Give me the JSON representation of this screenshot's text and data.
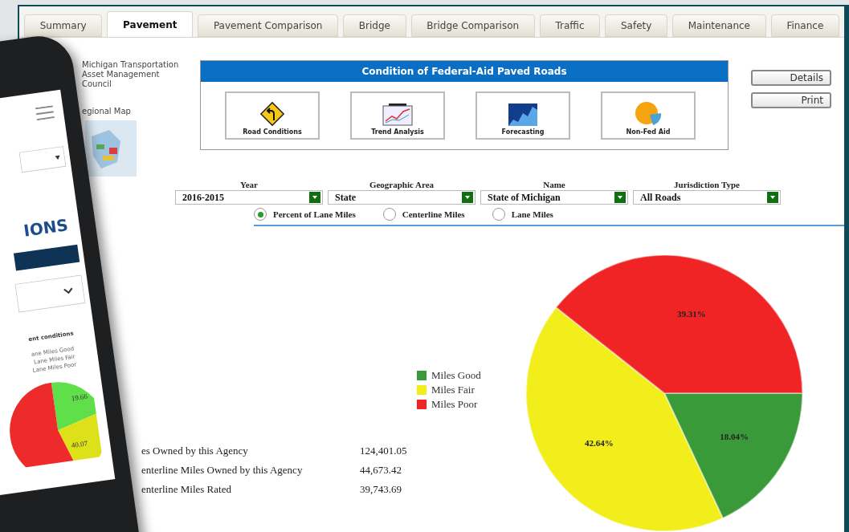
{
  "tabs": [
    {
      "label": "Summary",
      "selected": false
    },
    {
      "label": "Pavement",
      "selected": true
    },
    {
      "label": "Pavement Comparison",
      "selected": false
    },
    {
      "label": "Bridge",
      "selected": false
    },
    {
      "label": "Bridge Comparison",
      "selected": false
    },
    {
      "label": "Traffic",
      "selected": false
    },
    {
      "label": "Safety",
      "selected": false
    },
    {
      "label": "Maintenance",
      "selected": false
    },
    {
      "label": "Finance",
      "selected": false
    }
  ],
  "org_name": "Michigan Transportation Asset Management Council",
  "map_label": "egional Map",
  "panel": {
    "title": "Condition of Federal-Aid Paved Roads",
    "tiles": [
      {
        "kind": "sign",
        "caption": "Road Conditions"
      },
      {
        "kind": "trend",
        "caption": "Trend Analysis"
      },
      {
        "kind": "forecast",
        "caption": "Forecasting"
      },
      {
        "kind": "pie",
        "caption": "Non-Fed Aid"
      }
    ]
  },
  "buttons": [
    "Details",
    "Print"
  ],
  "filters": [
    {
      "label": "Year",
      "value": "2016-2015"
    },
    {
      "label": "Geographic Area",
      "value": "State"
    },
    {
      "label": "Name",
      "value": "State of Michigan"
    },
    {
      "label": "Jurisdiction Type",
      "value": "All Roads"
    }
  ],
  "radios": [
    {
      "label": "Percent of Lane Miles",
      "selected": true
    },
    {
      "label": "Centerline Miles",
      "selected": false
    },
    {
      "label": "Lane Miles",
      "selected": false
    }
  ],
  "legend": [
    {
      "color": "#3a9a3a"
    },
    {
      "color": "#f2ee1c"
    },
    {
      "color": "#f02424"
    }
  ],
  "chart_data": {
    "type": "pie",
    "categories": [
      "Miles Good",
      "Miles Fair",
      "Miles Poor"
    ],
    "values": [
      18.04,
      42.64,
      39.31
    ],
    "value_labels": [
      "18.04%",
      "42.64%",
      "39.31%"
    ]
  },
  "stats": [
    {
      "label": "es Owned by this Agency",
      "value": "124,401.05"
    },
    {
      "label": "enterline Miles Owned by this Agency",
      "value": "44,673.42"
    },
    {
      "label": "enterline Miles Rated",
      "value": "39,743.69"
    }
  ],
  "phone": {
    "heading": "IONS",
    "chart_title": "ent conditions",
    "legend": [
      "ane Miles Good",
      "Lane Miles Fair",
      "Lane Miles Poor"
    ],
    "pie_labels": [
      "19.66",
      "40.07"
    ]
  }
}
